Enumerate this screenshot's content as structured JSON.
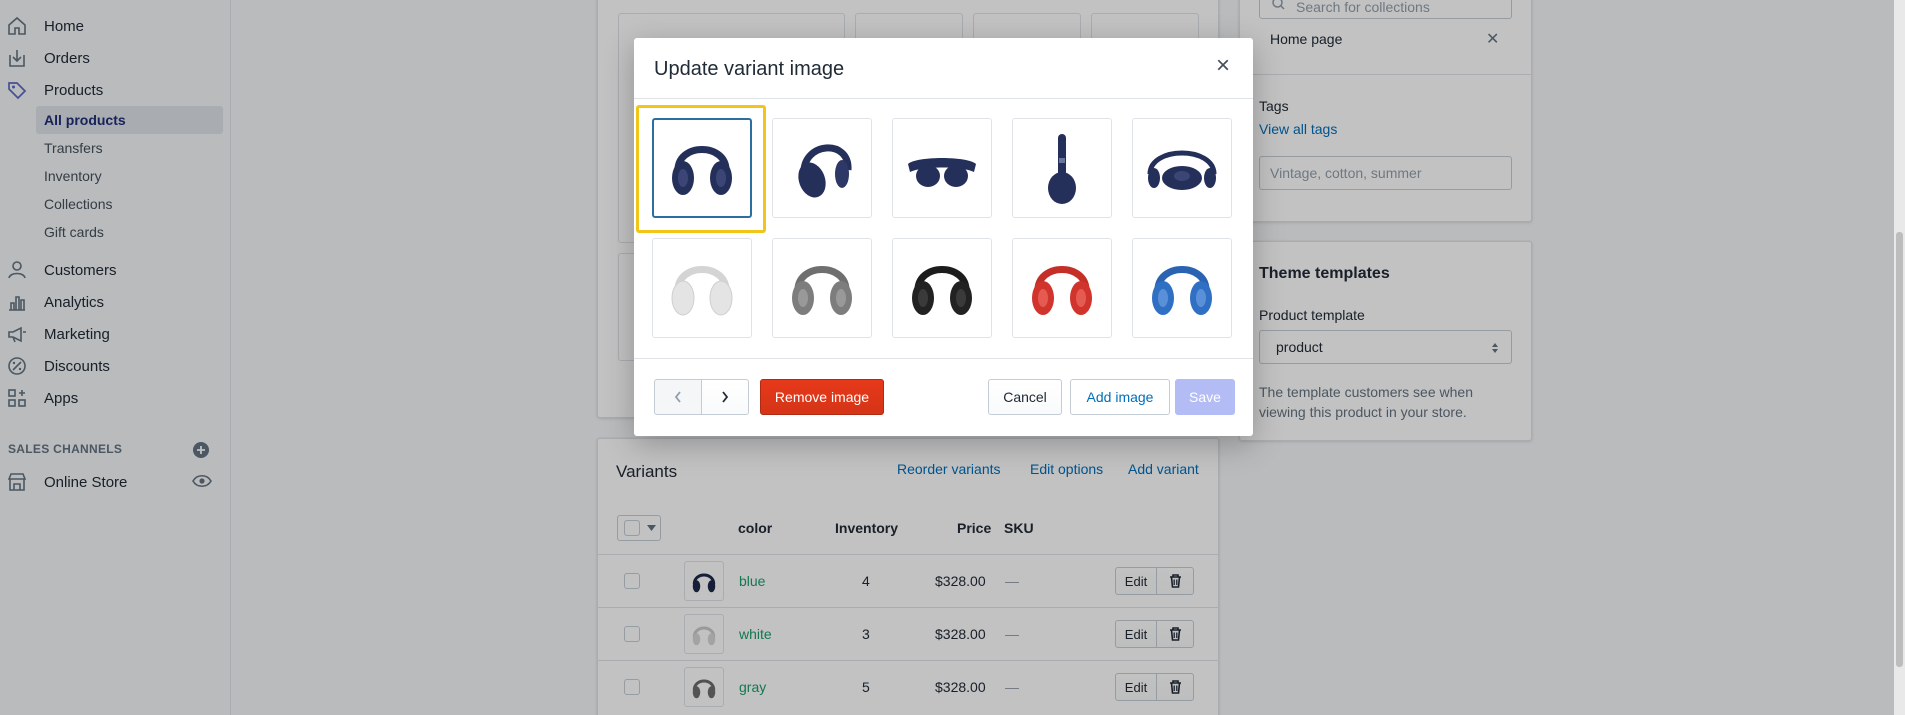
{
  "sidebar": {
    "nav": [
      {
        "label": "Home",
        "icon": "home-icon"
      },
      {
        "label": "Orders",
        "icon": "orders-icon"
      },
      {
        "label": "Products",
        "icon": "tag-icon"
      },
      {
        "label": "Customers",
        "icon": "person-icon"
      },
      {
        "label": "Analytics",
        "icon": "bar-chart-icon"
      },
      {
        "label": "Marketing",
        "icon": "megaphone-icon"
      },
      {
        "label": "Discounts",
        "icon": "discount-icon"
      },
      {
        "label": "Apps",
        "icon": "apps-icon"
      }
    ],
    "products_sub": [
      "All products",
      "Transfers",
      "Inventory",
      "Collections",
      "Gift cards"
    ],
    "sales_channels_title": "SALES CHANNELS",
    "online_store": "Online Store"
  },
  "right_panel": {
    "collections_placeholder": "Search for collections",
    "collection_tag": "Home page",
    "tags_label": "Tags",
    "view_all_tags": "View all tags",
    "tags_placeholder": "Vintage, cotton, summer",
    "theme_title": "Theme templates",
    "product_template_label": "Product template",
    "product_template_value": "product",
    "theme_help": "The template customers see when viewing this product in your store."
  },
  "variants": {
    "title": "Variants",
    "links": [
      "Reorder variants",
      "Edit options",
      "Add variant"
    ],
    "headers": {
      "color": "color",
      "inventory": "Inventory",
      "price": "Price",
      "sku": "SKU"
    },
    "rows": [
      {
        "color": "blue",
        "inventory": "4",
        "price": "$328.00",
        "sku": "—",
        "swatch": "#1f2a4a"
      },
      {
        "color": "white",
        "inventory": "3",
        "price": "$328.00",
        "sku": "—",
        "swatch": "#e6e6e6"
      },
      {
        "color": "gray",
        "inventory": "5",
        "price": "$328.00",
        "sku": "—",
        "swatch": "#7a7a7a"
      }
    ],
    "edit_label": "Edit"
  },
  "modal": {
    "title": "Update variant image",
    "images": [
      {
        "name": "navy-front",
        "color": "#25305a"
      },
      {
        "name": "navy-side",
        "color": "#25305a"
      },
      {
        "name": "navy-folded",
        "color": "#25305a"
      },
      {
        "name": "navy-profile",
        "color": "#25305a"
      },
      {
        "name": "navy-case",
        "color": "#25305a"
      },
      {
        "name": "white-front",
        "color": "#e4e4e4"
      },
      {
        "name": "gray-front",
        "color": "#7d7d7d"
      },
      {
        "name": "black-front",
        "color": "#222222"
      },
      {
        "name": "red-front",
        "color": "#d0342c"
      },
      {
        "name": "blue-front",
        "color": "#2f6fc4"
      }
    ],
    "remove_label": "Remove image",
    "cancel_label": "Cancel",
    "add_label": "Add image",
    "save_label": "Save"
  },
  "colors": {
    "accent_link": "#006fbb",
    "danger": "#d53417",
    "selection_highlight": "#f2c519",
    "variant_link": "#1a9e6b"
  }
}
